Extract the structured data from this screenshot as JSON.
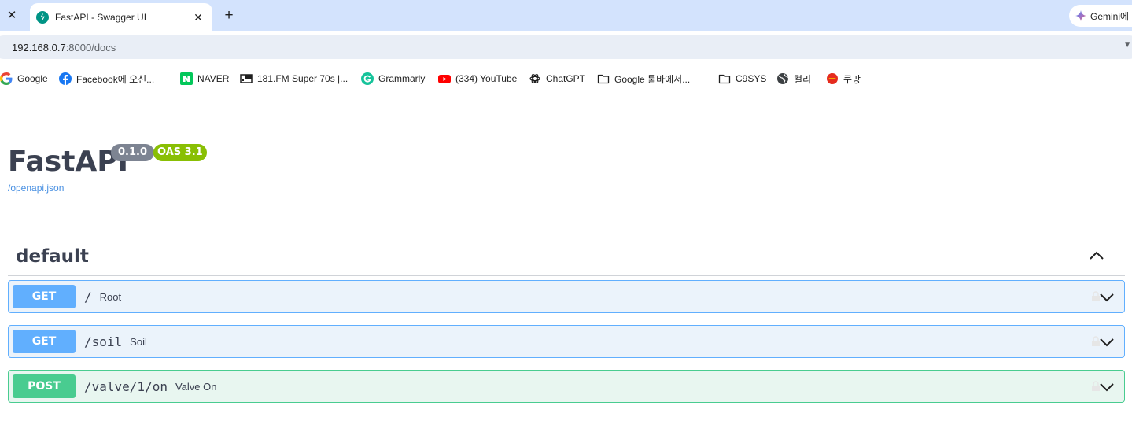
{
  "browser": {
    "prev_tab_close": "✕",
    "tab_title": "FastAPI - Swagger UI",
    "tab_close": "✕",
    "new_tab": "+",
    "gemini_label": "Gemini에",
    "url_host": "192.168.0.7",
    "url_path": ":8000/docs"
  },
  "bookmarks": [
    {
      "label": "Google",
      "icon": "google-icon"
    },
    {
      "label": "Facebook에 오신...",
      "icon": "facebook-icon"
    },
    {
      "label": "NAVER",
      "icon": "naver-icon"
    },
    {
      "label": "181.FM Super 70s |...",
      "icon": "radio-icon"
    },
    {
      "label": "Grammarly",
      "icon": "grammarly-icon"
    },
    {
      "label": "(334) YouTube",
      "icon": "youtube-icon"
    },
    {
      "label": "ChatGPT",
      "icon": "chatgpt-icon"
    },
    {
      "label": "Google 툴바에서...",
      "icon": "folder-icon"
    },
    {
      "label": "C9SYS",
      "icon": "folder-icon"
    },
    {
      "label": "컬리",
      "icon": "globe-icon"
    },
    {
      "label": "쿠팡",
      "icon": "coupang-icon"
    }
  ],
  "swagger": {
    "title": "FastAPI",
    "version": "0.1.0",
    "oas": "OAS 3.1",
    "openapi_link": "/openapi.json",
    "tag": "default",
    "operations": [
      {
        "method": "GET",
        "path": "/",
        "summary": "Root"
      },
      {
        "method": "GET",
        "path": "/soil",
        "summary": "Soil"
      },
      {
        "method": "POST",
        "path": "/valve/1/on",
        "summary": "Valve On"
      }
    ]
  },
  "colors": {
    "get": "#61affe",
    "post": "#49cc90",
    "version_badge": "#7d8492",
    "oas_badge": "#89bf04",
    "link": "#4990e2"
  }
}
